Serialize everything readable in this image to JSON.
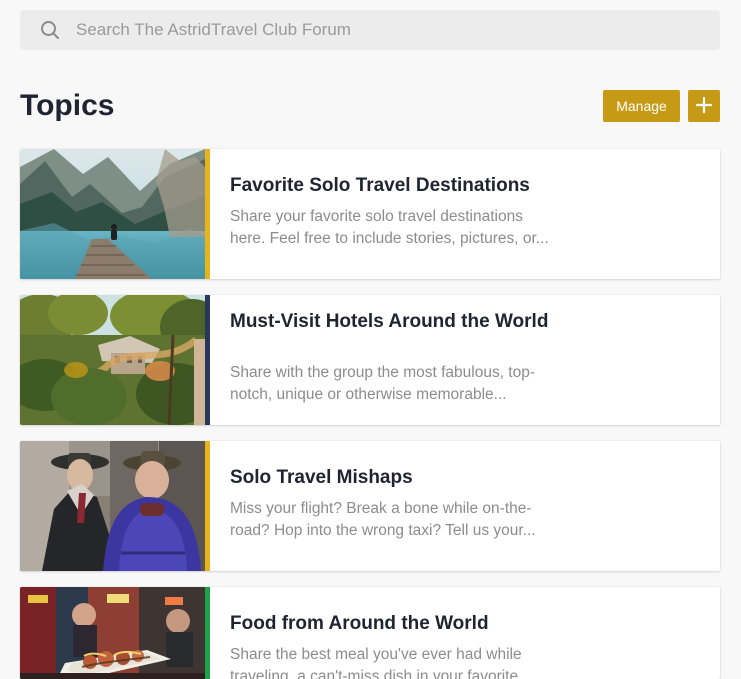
{
  "search": {
    "placeholder": "Search The AstridTravel Club Forum",
    "icon": "search-icon"
  },
  "topics_header": {
    "title": "Topics",
    "manage_label": "Manage",
    "add_icon": "plus-icon",
    "accent_color": "#c79a16"
  },
  "topics": [
    {
      "title": "Favorite Solo Travel Destinations",
      "description": "Share your favorite solo travel destinations here. Feel free to include stories, pictures, or...",
      "accent_color": "#e7b51a",
      "image_name": "mountain-lake-dock-image"
    },
    {
      "title": "Must-Visit Hotels Around the World",
      "description": "Share with the group the most fabulous, top-notch, unique or otherwise memorable...",
      "accent_color": "#27385a",
      "image_name": "garden-hotel-image"
    },
    {
      "title": "Solo Travel Mishaps",
      "description": "Miss your flight? Break a bone while on-the-road? Hop into the wrong taxi? Tell us your...",
      "accent_color": "#e7b51a",
      "image_name": "two-men-coats-image"
    },
    {
      "title": "Food from Around the World",
      "description": "Share the best meal you've ever had while traveling, a can't-miss dish in your favorite...",
      "accent_color": "#1da34a",
      "image_name": "street-food-image"
    }
  ]
}
